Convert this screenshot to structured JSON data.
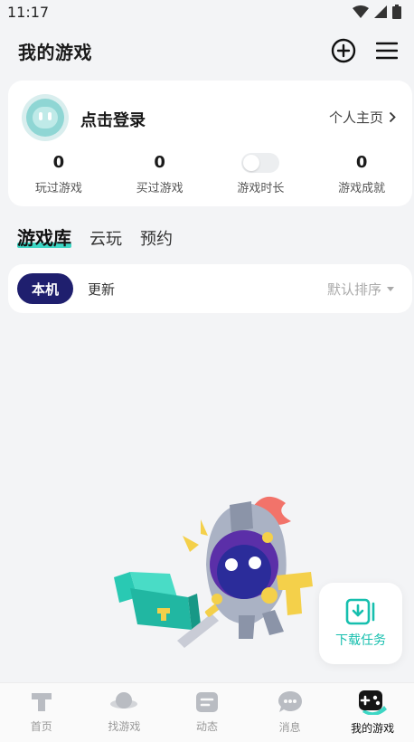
{
  "status": {
    "time": "11:17"
  },
  "header": {
    "title": "我的游戏"
  },
  "profile": {
    "login": "点击登录",
    "home_link": "个人主页",
    "stats": [
      {
        "value": "0",
        "label": "玩过游戏"
      },
      {
        "value": "0",
        "label": "买过游戏"
      },
      {
        "value": "",
        "label": "游戏时长"
      },
      {
        "value": "0",
        "label": "游戏成就"
      }
    ],
    "playtime_toggle_on": false
  },
  "tabs": [
    {
      "label": "游戏库",
      "active": true
    },
    {
      "label": "云玩",
      "active": false
    },
    {
      "label": "预约",
      "active": false
    }
  ],
  "filter": {
    "local": "本机",
    "update": "更新",
    "sort": "默认排序"
  },
  "download": {
    "label": "下载任务"
  },
  "tabbar": [
    {
      "label": "首页",
      "icon": "home-icon",
      "active": false
    },
    {
      "label": "找游戏",
      "icon": "planet-icon",
      "active": false
    },
    {
      "label": "动态",
      "icon": "feed-icon",
      "active": false
    },
    {
      "label": "消息",
      "icon": "chat-bubble-icon",
      "active": false
    },
    {
      "label": "我的游戏",
      "icon": "gamepad-icon",
      "active": true
    }
  ],
  "colors": {
    "accent": "#3dd6c4",
    "pill": "#1f1f6e",
    "background": "#f3f4f6"
  }
}
